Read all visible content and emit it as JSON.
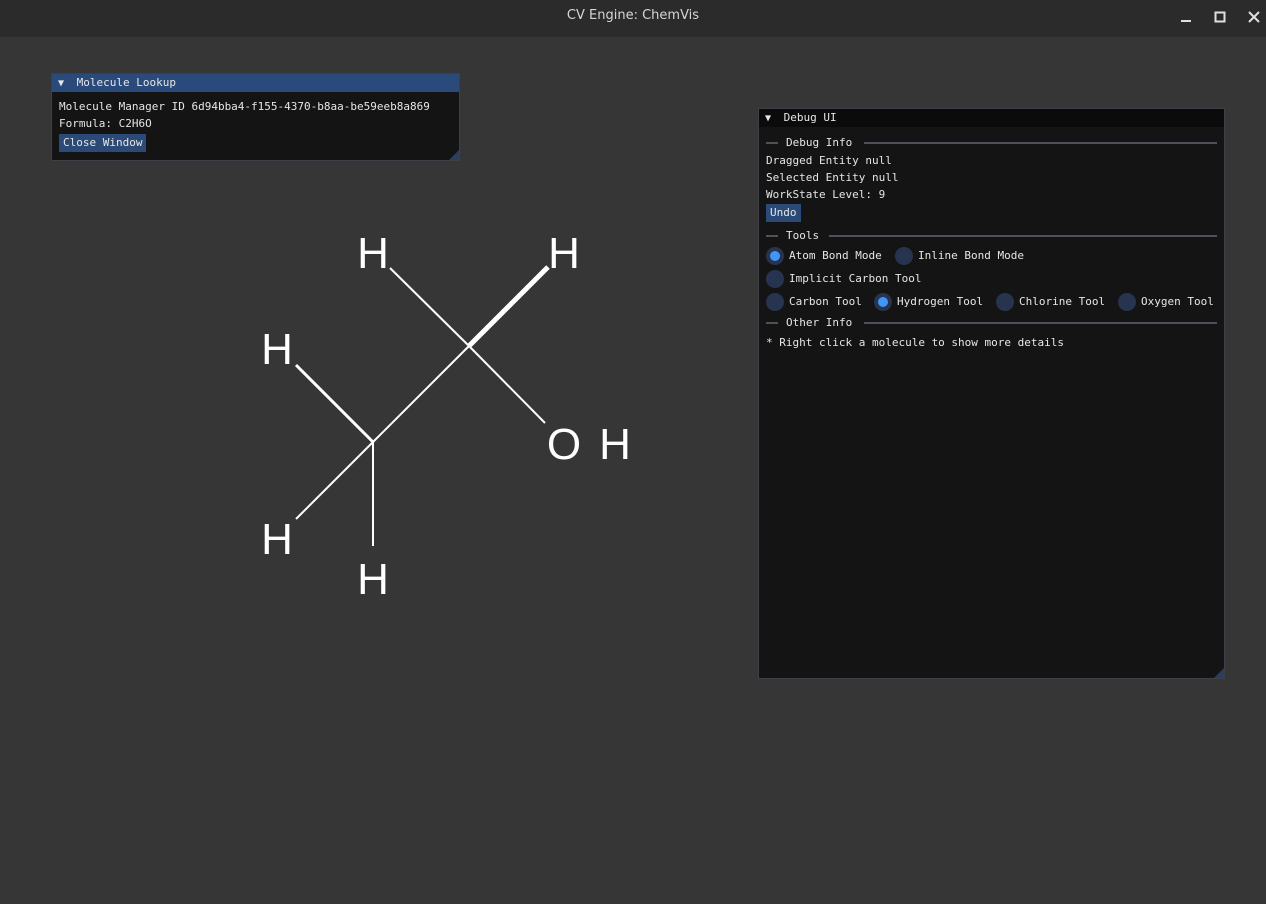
{
  "window": {
    "title": "CV Engine: ChemVis",
    "controls": [
      "minimize-icon",
      "maximize-icon",
      "close-icon"
    ]
  },
  "molecule_lookup": {
    "title": "Molecule Lookup",
    "manager_id_label": "Molecule Manager ID 6d94bba4-f155-4370-b8aa-be59eeb8a869",
    "formula_label": "Formula: C2H6O",
    "close_button": "Close Window"
  },
  "debug_ui": {
    "title": "Debug UI",
    "debug_info_header": "Debug Info",
    "dragged_entity": "Dragged Entity null",
    "selected_entity": "Selected Entity null",
    "workstate_level": "WorkState Level: 9",
    "undo_button": "Undo",
    "tools_header": "Tools",
    "modes": [
      {
        "label": "Atom Bond Mode",
        "selected": true
      },
      {
        "label": "Inline Bond Mode",
        "selected": false
      }
    ],
    "implicit_carbon": {
      "label": "Implicit Carbon Tool",
      "selected": false
    },
    "tools": [
      {
        "label": "Carbon Tool",
        "selected": false
      },
      {
        "label": "Hydrogen Tool",
        "selected": true
      },
      {
        "label": "Chlorine Tool",
        "selected": false
      },
      {
        "label": "Oxygen Tool",
        "selected": false
      }
    ],
    "other_info_header": "Other Info",
    "hint": "* Right click a molecule to show more details"
  },
  "molecule": {
    "atoms": {
      "h1": "H",
      "h2": "H",
      "h3": "H",
      "h4": "H",
      "h5": "H",
      "o": "O",
      "h6": "H"
    }
  },
  "colors": {
    "background": "#363636",
    "panel": "#141414",
    "title_active": "#294a7a",
    "button": "#2b4a77",
    "radio_check": "#4296fa",
    "bond": "#ffffff"
  }
}
